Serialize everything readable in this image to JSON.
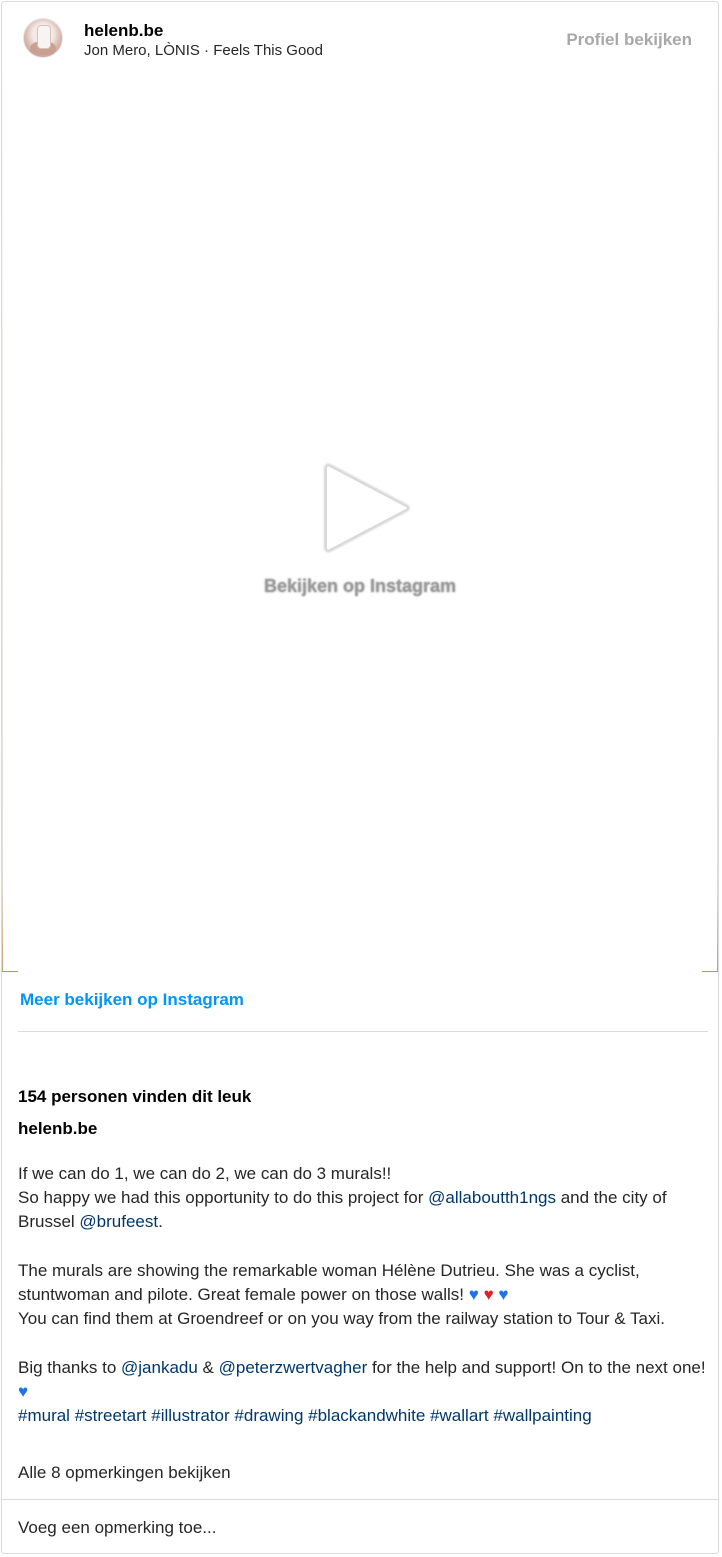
{
  "header": {
    "username": "helenb.be",
    "subline": "Jon Mero, LÒNIS · Feels This Good",
    "profile_button": "Profiel bekijken"
  },
  "media": {
    "watch_label": "Bekijken op Instagram",
    "play_icon": "play-icon"
  },
  "more_link": "Meer bekijken op Instagram",
  "likes": "154 personen vinden dit leuk",
  "owner": "helenb.be",
  "caption": {
    "line1": "If we can do 1, we can do 2, we can do 3 murals!!",
    "line2_a": "So happy we had this opportunity to do this project for ",
    "mention1": "@allaboutth1ngs",
    "line2_b": " and the city of Brussel ",
    "mention2": "@brufeest",
    "line2_c": ".",
    "para2_a": "The murals are showing the remarkable woman Hélène Dutrieu. She was a cyclist, stuntwoman and pilote. Great female power on those walls! ",
    "para2_b": "You can find them at Groendreef or on you way from the railway station to Tour & Taxi.",
    "para3_a": "Big thanks to ",
    "mention3": "@jankadu",
    "para3_b": " & ",
    "mention4": "@peterzwertvagher",
    "para3_c": " for the help and support! On to the next one! ",
    "hashtags": [
      "#mural",
      "#streetart",
      "#illustrator",
      "#drawing",
      "#blackandwhite",
      "#wallart",
      "#wallpainting"
    ]
  },
  "comments_link": "Alle 8 opmerkingen bekijken",
  "comment_placeholder": "Voeg een opmerking toe...",
  "colors": {
    "link_blue": "#0095f6",
    "mention_blue": "#00376b",
    "muted_gray": "#a8a8a8"
  }
}
